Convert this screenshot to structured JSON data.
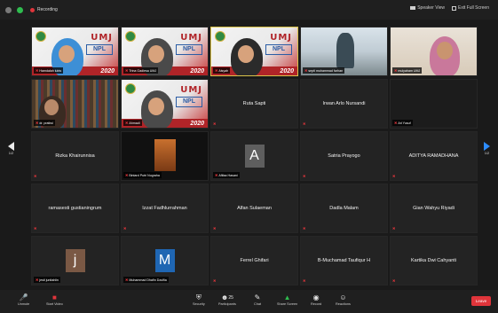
{
  "topbar": {
    "recording_label": "Recording",
    "speaker_view_label": "Speaker View",
    "exit_full_screen_label": "Exit Full Screen"
  },
  "tiles": [
    {
      "name": "Hamdalah lubis",
      "kind": "video-banner"
    },
    {
      "name": "Trina Gadiesa UMJ",
      "kind": "video-banner"
    },
    {
      "name": "Aisyah",
      "kind": "video-banner",
      "active": true
    },
    {
      "name": "septi muhammad farhan",
      "kind": "video-outdoor"
    },
    {
      "name": "mulyaham UMJ",
      "kind": "video-indoor"
    },
    {
      "name": "dr. pratiwi",
      "kind": "video-books"
    },
    {
      "name": "Ahmadi",
      "kind": "video-banner"
    },
    {
      "name": "Ruta Sapti",
      "kind": "name-only"
    },
    {
      "name": "Irwan Arlo Nursandi",
      "kind": "name-only"
    },
    {
      "name": "Ari Yusuf",
      "kind": "black"
    },
    {
      "name": "Rizka Khairunnisa",
      "kind": "name-only"
    },
    {
      "name": "Bintard Putri Nugraha",
      "kind": "video-dark"
    },
    {
      "name": "Afifaa Hasani",
      "kind": "avatar",
      "letter": "A",
      "color": "#5e5e5e"
    },
    {
      "name": "Satria Prayogo",
      "kind": "name-only"
    },
    {
      "name": "ADITYA RAMADHANA",
      "kind": "name-only"
    },
    {
      "name": "ramasesti gustianingrum",
      "kind": "name-only"
    },
    {
      "name": "Izzat Fadhlurrahman",
      "kind": "name-only"
    },
    {
      "name": "Alfan Sulaeman",
      "kind": "name-only"
    },
    {
      "name": "Dadla Malam",
      "kind": "name-only"
    },
    {
      "name": "Gian Wahyu Riyadi",
      "kind": "name-only"
    },
    {
      "name": "jesti junitahlin",
      "kind": "avatar",
      "letter": "j",
      "color": "#7a5844"
    },
    {
      "name": "Muhammad Dhafin Dzulfia",
      "kind": "avatar",
      "letter": "M",
      "color": "#1f66b3"
    },
    {
      "name": "Ferrel Ghifari",
      "kind": "name-only"
    },
    {
      "name": "B-Muchamad Taufiqur H",
      "kind": "name-only"
    },
    {
      "name": "Kartika Dwi Cahyanti",
      "kind": "name-only"
    }
  ],
  "banner": {
    "brand": "UMJ",
    "tag": "NPL",
    "year": "2020"
  },
  "pager": {
    "left_page": "1/2",
    "right_page": "1/2"
  },
  "toolbar": {
    "unmute": "Unmute",
    "start_video": "Start Video",
    "security": "Security",
    "participants": "Participants",
    "participants_count": "25",
    "chat": "Chat",
    "share_screen": "Share Screen",
    "record": "Record",
    "reactions": "Reactions",
    "leave": "Leave"
  },
  "colors": {
    "active_border": "#d9c34a",
    "muted_red": "#e0353b",
    "share_green": "#2fbd4f",
    "next_arrow_blue": "#2d8cff"
  }
}
